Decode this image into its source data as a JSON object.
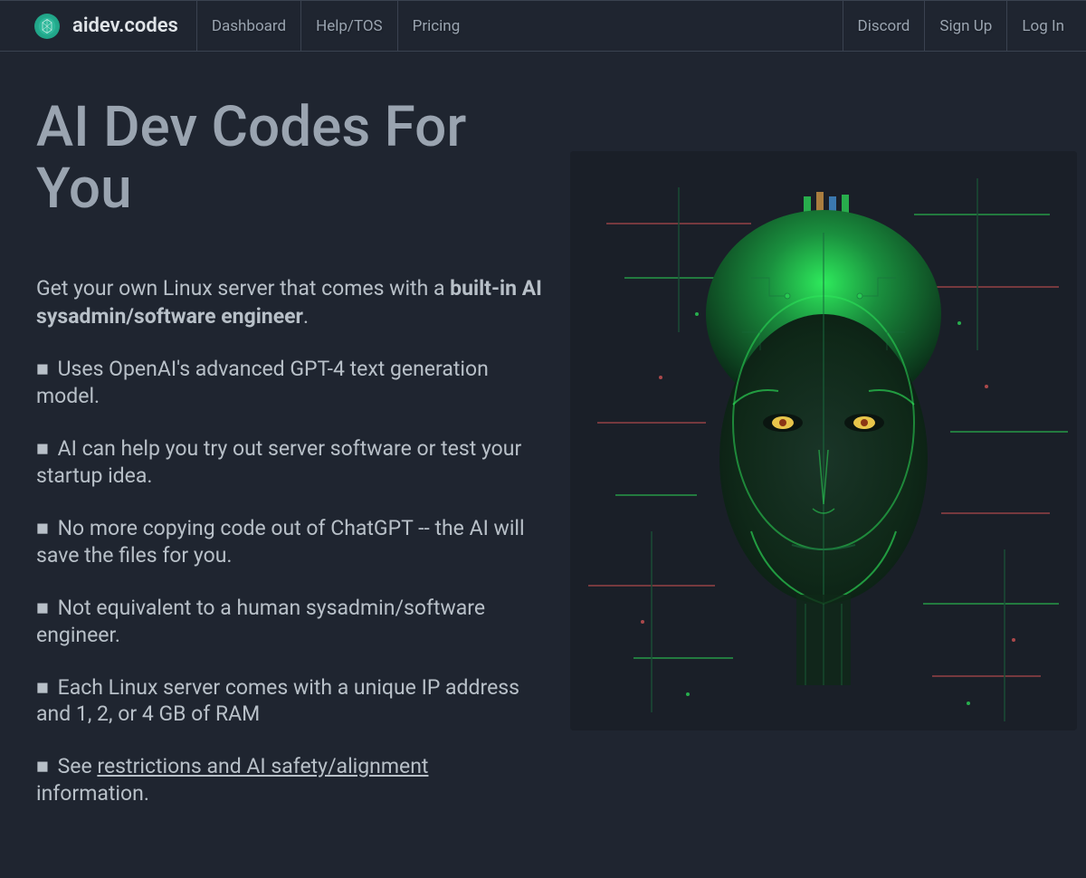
{
  "brand": {
    "name": "aidev.codes"
  },
  "nav": {
    "left": [
      {
        "label": "Dashboard"
      },
      {
        "label": "Help/TOS"
      },
      {
        "label": "Pricing"
      }
    ],
    "right": [
      {
        "label": "Discord"
      },
      {
        "label": "Sign Up"
      },
      {
        "label": "Log In"
      }
    ]
  },
  "hero": {
    "title": "AI Dev Codes For You",
    "intro_prefix": "Get your own Linux server that comes with a ",
    "intro_bold": "built-in AI sysadmin/software engineer",
    "intro_suffix": ".",
    "bullets": [
      "Uses OpenAI's advanced GPT-4 text generation model.",
      "AI can help you try out server software or test your startup idea.",
      "No more copying code out of ChatGPT -- the AI will save the files for you.",
      "Not equivalent to a human sysadmin/software engineer.",
      "Each Linux server comes with a unique IP address and 1, 2, or 4 GB of RAM"
    ],
    "last_bullet_prefix": "See ",
    "last_bullet_link": "restrictions and AI safety/alignment",
    "last_bullet_suffix": " information.",
    "image_alt": "ai-head-illustration"
  }
}
